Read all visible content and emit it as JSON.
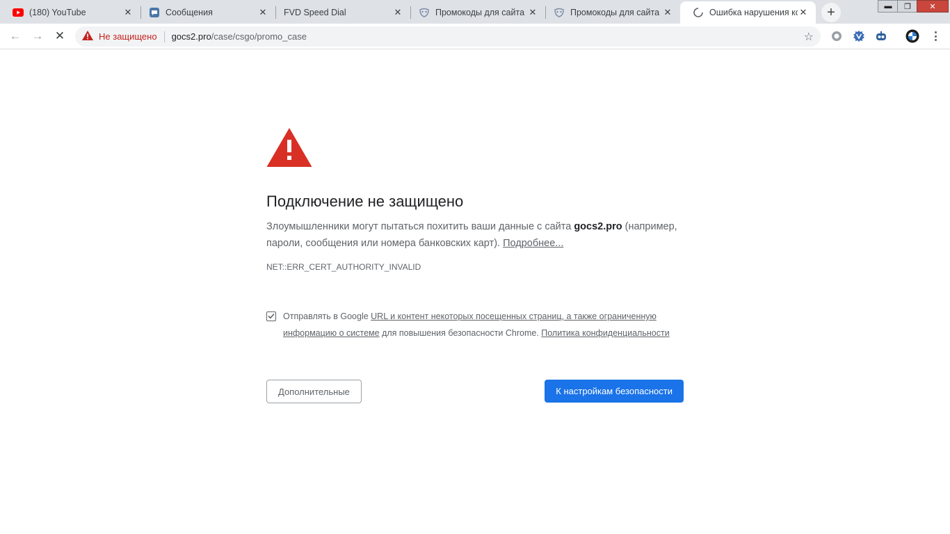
{
  "tabs": [
    {
      "title": "(180) YouTube",
      "icon": "youtube-icon"
    },
    {
      "title": "Сообщения",
      "icon": "messages-icon"
    },
    {
      "title": "FVD Speed Dial",
      "icon": ""
    },
    {
      "title": "Промокоды для сайта с",
      "icon": "mask-icon"
    },
    {
      "title": "Промокоды для сайта с",
      "icon": "mask-icon"
    },
    {
      "title": "Ошибка нарушения ко",
      "icon": "loading-spinner-icon",
      "active": true
    }
  ],
  "toolbar": {
    "security_label": "Не защищено",
    "url_host": "gocs2.pro",
    "url_path": "/case/csgo/promo_case"
  },
  "interstitial": {
    "heading": "Подключение не защищено",
    "explanation_prefix": "Злоумышленники могут пытаться похитить ваши данные с сайта ",
    "site": "gocs2.pro",
    "explanation_suffix": " (например, пароли, сообщения или номера банковских карт). ",
    "learn_more": "Подробнее...",
    "error_code": "NET::ERR_CERT_AUTHORITY_INVALID",
    "optin_prefix": "Отправлять в Google ",
    "optin_link1": "URL и контент некоторых посещенных страниц, а также ограниченную информацию о системе",
    "optin_middle": " для повышения безопасности Chrome. ",
    "optin_link2": "Политика конфиденциальности",
    "optin_checked": true,
    "details_button": "Дополнительные",
    "primary_button": "К настройкам безопасности"
  },
  "colors": {
    "warning_red": "#d93025",
    "primary_blue": "#1a73e8"
  }
}
